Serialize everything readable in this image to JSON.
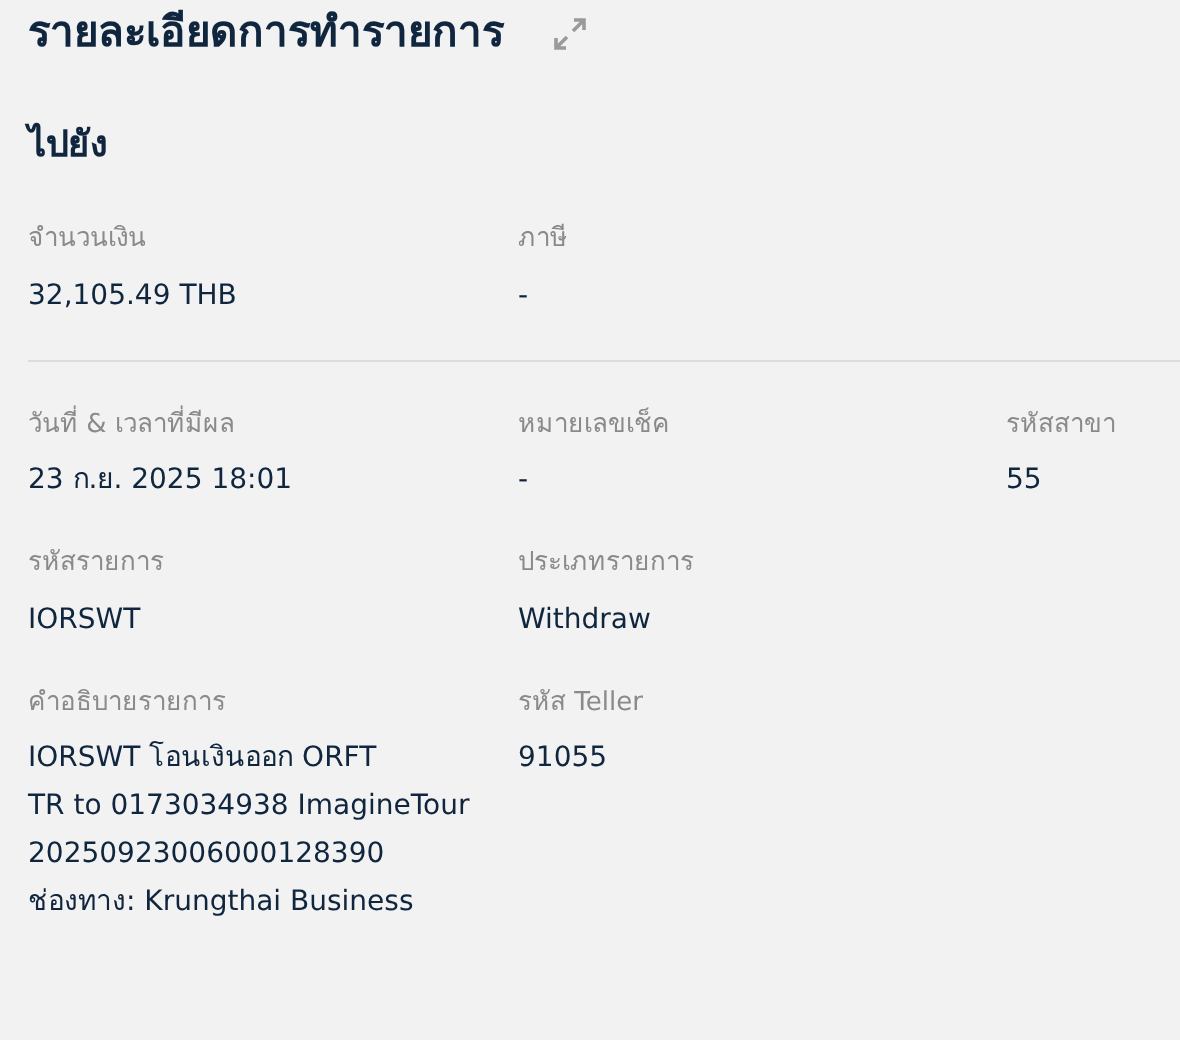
{
  "title": "รายละเอียดการทำรายการ",
  "section_heading": "ไปยัง",
  "groups": [
    {
      "rows": [
        [
          {
            "label": "จำนวนเงิน",
            "lines": [
              "32,105.49 THB"
            ]
          },
          {
            "label": "ภาษี",
            "lines": [
              "-"
            ]
          }
        ]
      ]
    },
    {
      "rows": [
        [
          {
            "label": "วันที่ & เวลาที่มีผล",
            "lines": [
              "23 ก.ย. 2025 18:01"
            ]
          },
          {
            "label": "หมายเลขเช็ค",
            "lines": [
              "-"
            ]
          },
          {
            "label": "รหัสสาขา",
            "lines": [
              "55"
            ]
          }
        ],
        [
          {
            "label": "รหัสรายการ",
            "lines": [
              "IORSWT"
            ]
          },
          {
            "label": "ประเภทรายการ",
            "lines": [
              "Withdraw"
            ]
          }
        ],
        [
          {
            "label": "คำอธิบายรายการ",
            "lines": [
              "IORSWT โอนเงินออก ORFT",
              "TR to 0173034938 ImagineTour",
              "20250923006000128390",
              "ช่องทาง: Krungthai Business"
            ]
          },
          {
            "label": "รหัส Teller",
            "lines": [
              "91055"
            ]
          }
        ]
      ]
    }
  ]
}
